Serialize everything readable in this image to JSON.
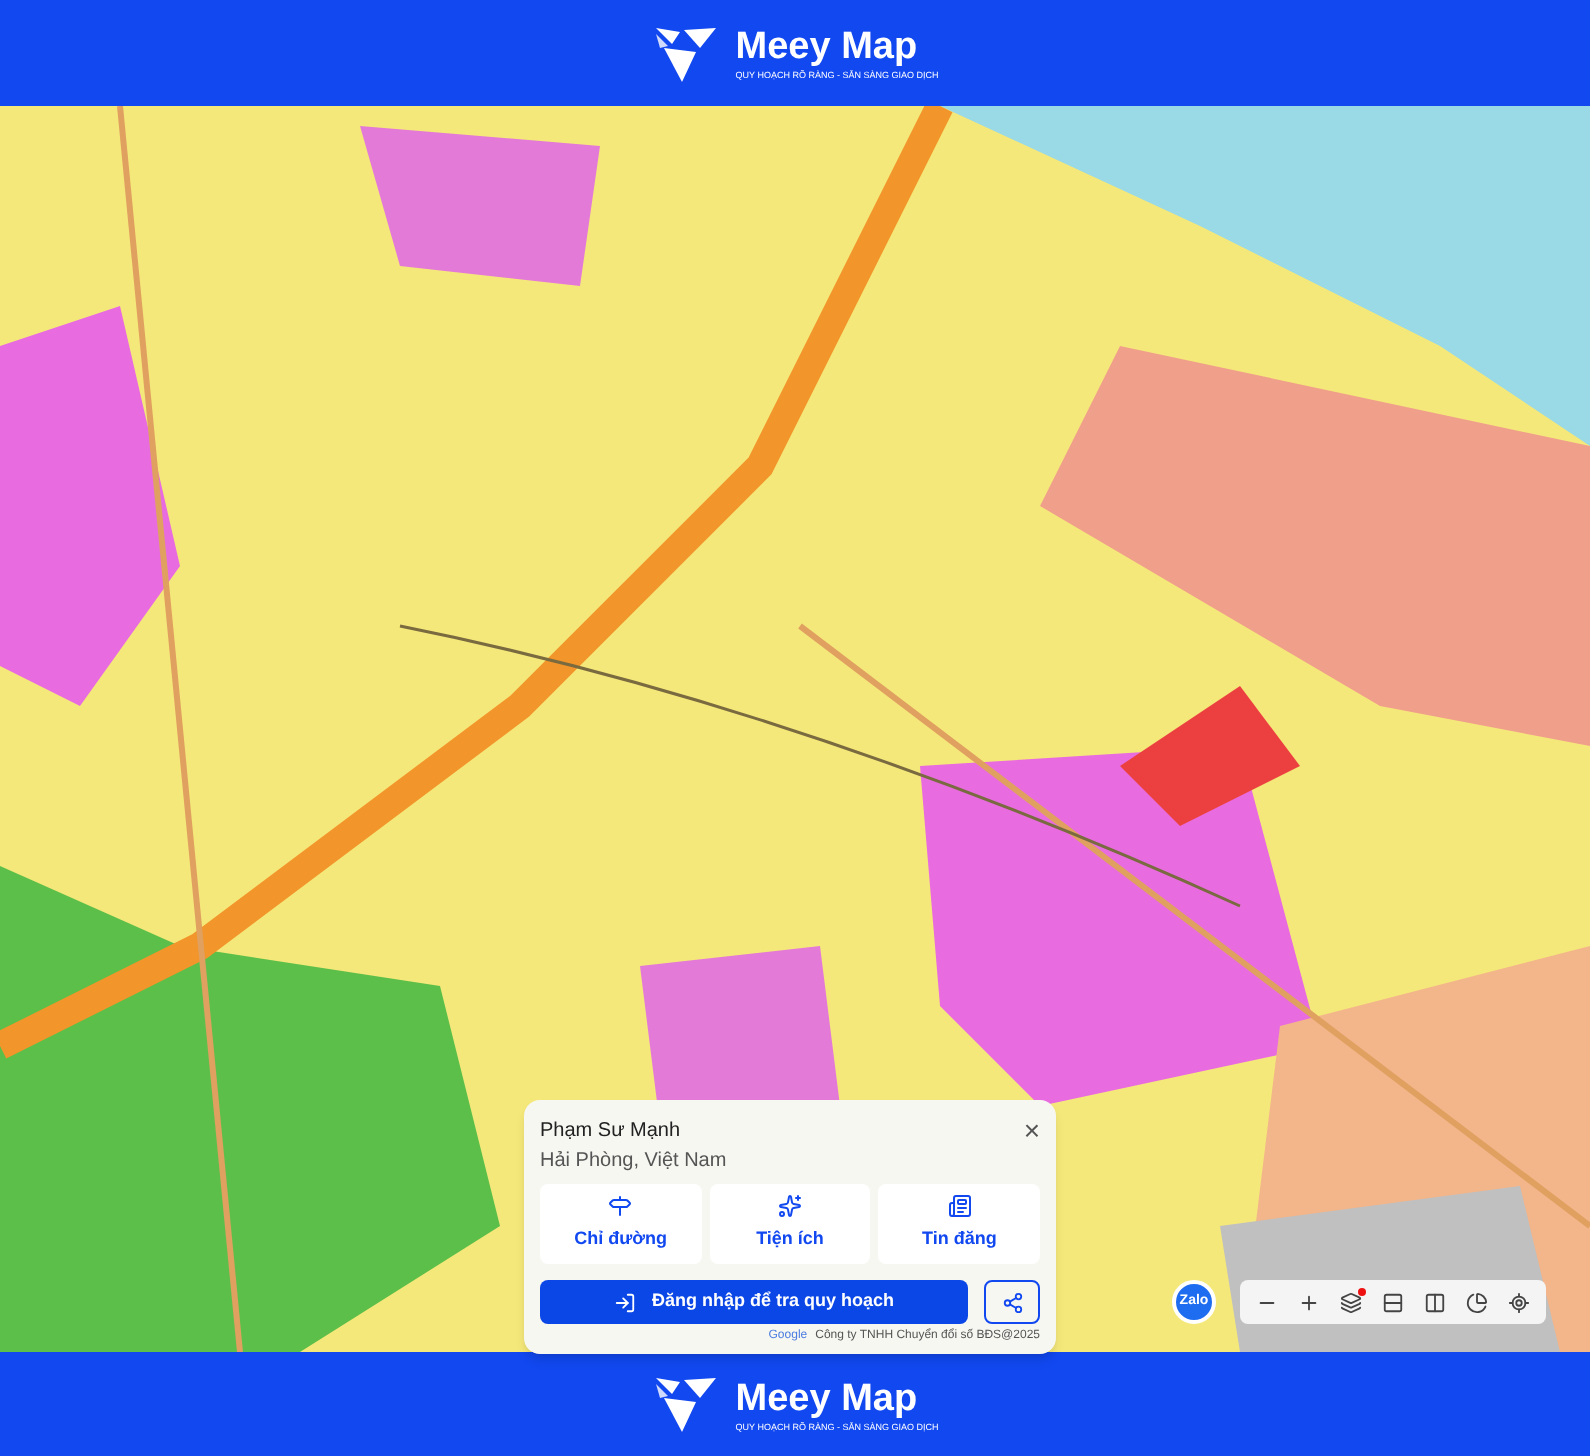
{
  "header": {
    "brand": "Meey Map",
    "tagline": "QUY HOẠCH RÕ RÀNG - SẴN SÀNG GIAO DỊCH"
  },
  "place_card": {
    "title": "Phạm Sư Mạnh",
    "subtitle": "Hải Phòng, Việt Nam",
    "close": "×",
    "actions": [
      {
        "kind": "directions",
        "label": "Chỉ đường"
      },
      {
        "kind": "amenities",
        "label": "Tiện ích"
      },
      {
        "kind": "listings",
        "label": "Tin đăng"
      }
    ],
    "login_button": "Đăng nhập để tra quy hoạch",
    "attribution": {
      "logo": "Google",
      "text": "Công ty TNHH Chuyển đổi số BĐS@2025"
    }
  },
  "zalo_button": "Zalo",
  "map_toolbar": [
    {
      "kind": "zoom-out"
    },
    {
      "kind": "zoom-in"
    },
    {
      "kind": "layers",
      "badge": true
    },
    {
      "kind": "compare"
    },
    {
      "kind": "split"
    },
    {
      "kind": "chart"
    },
    {
      "kind": "locate"
    }
  ],
  "footer": {
    "brand": "Meey Map",
    "tagline": "QUY HOẠCH RÕ RÀNG - SẴN SÀNG GIAO DỊCH"
  }
}
